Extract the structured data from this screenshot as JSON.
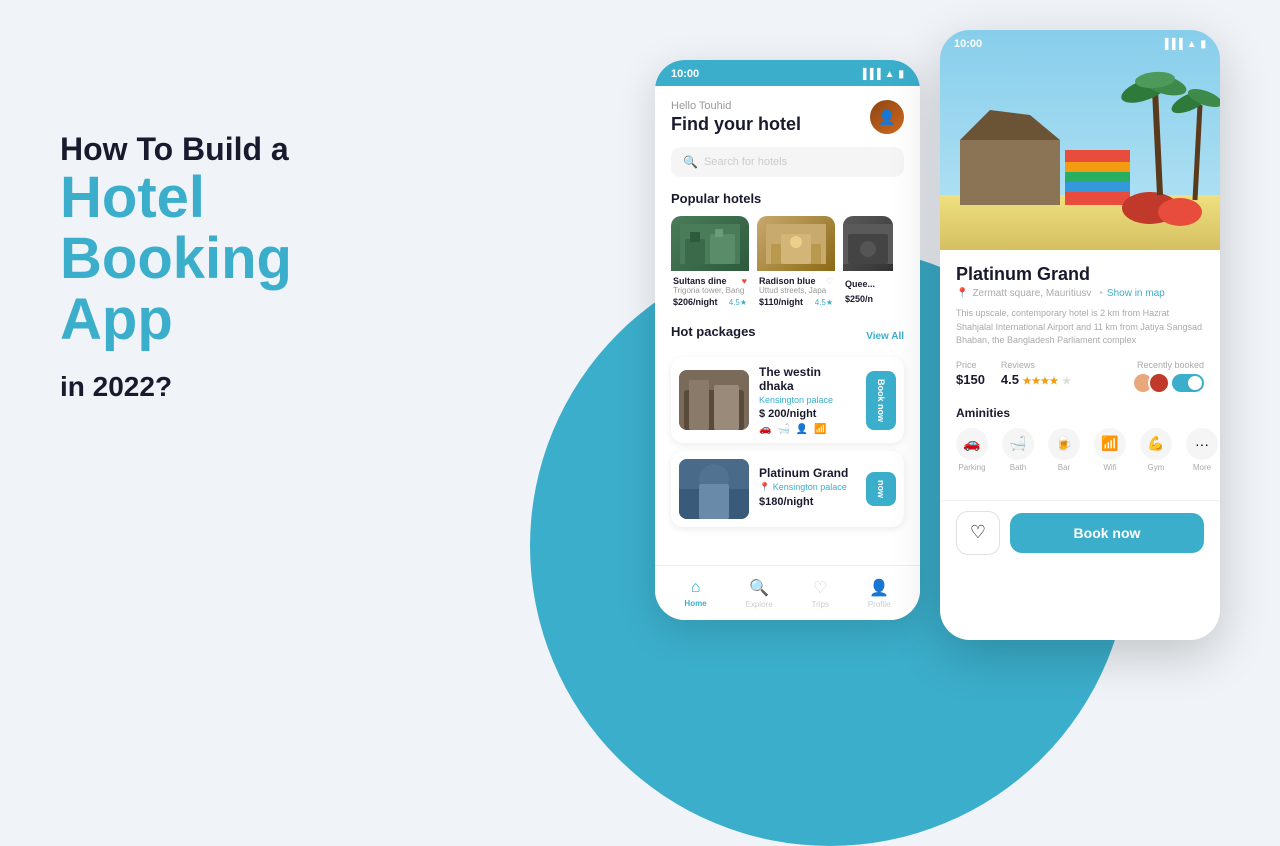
{
  "page": {
    "background_circle_color": "#3baecb"
  },
  "left": {
    "line1": "How To Build a",
    "line2": "Hotel",
    "line3": "Booking",
    "line4": "App",
    "line5": "in 2022?"
  },
  "phone1": {
    "status_time": "10:00",
    "greeting": "Hello Touhid",
    "title": "Find your hotel",
    "search_placeholder": "Search for hotels",
    "popular_hotels_label": "Popular hotels",
    "hotels": [
      {
        "name": "Sultans dine",
        "location": "Trigoria tower, Bang",
        "price": "$206/night",
        "rating": "4.5"
      },
      {
        "name": "Radison blue",
        "location": "Uttud streets, Japa",
        "price": "$110/night",
        "rating": "4.5"
      },
      {
        "name": "Quee...",
        "location": "",
        "price": "$250/n",
        "rating": ""
      }
    ],
    "hot_packages_label": "Hot packages",
    "view_all_label": "View All",
    "packages": [
      {
        "name": "The westin dhaka",
        "location": "Kensington palace",
        "price": "$ 200/night",
        "book_label": "Book now"
      },
      {
        "name": "Platinum Grand",
        "location": "Kensington palace",
        "price": "$180/night",
        "book_label": "now"
      }
    ],
    "nav": {
      "home": "Home",
      "explore": "Explore",
      "trips": "Trips",
      "profile": "Profile"
    }
  },
  "phone2": {
    "status_time": "10:00",
    "hotel_name": "Platinum Grand",
    "hotel_location": "Zermatt square, Mauritiusv",
    "show_map_label": "Show in map",
    "description": "This upscale, contemporary hotel is 2 km from Hazrat Shahjalal International Airport and 11 km from Jatiya Sangsad Bhaban, the Bangladesh Parliament complex",
    "price_label": "Price",
    "price_value": "$150",
    "reviews_label": "Reviews",
    "reviews_value": "4.5",
    "recently_booked_label": "Recently booked",
    "amenities_label": "Aminities",
    "amenities": [
      {
        "icon": "🚗",
        "label": "Parking"
      },
      {
        "icon": "🛁",
        "label": "Bath"
      },
      {
        "icon": "🍺",
        "label": "Bar"
      },
      {
        "icon": "📶",
        "label": "Wifi"
      },
      {
        "icon": "💪",
        "label": "Gym"
      },
      {
        "icon": "•••",
        "label": "More"
      }
    ],
    "book_now_label": "Book now",
    "back_label": "‹"
  }
}
